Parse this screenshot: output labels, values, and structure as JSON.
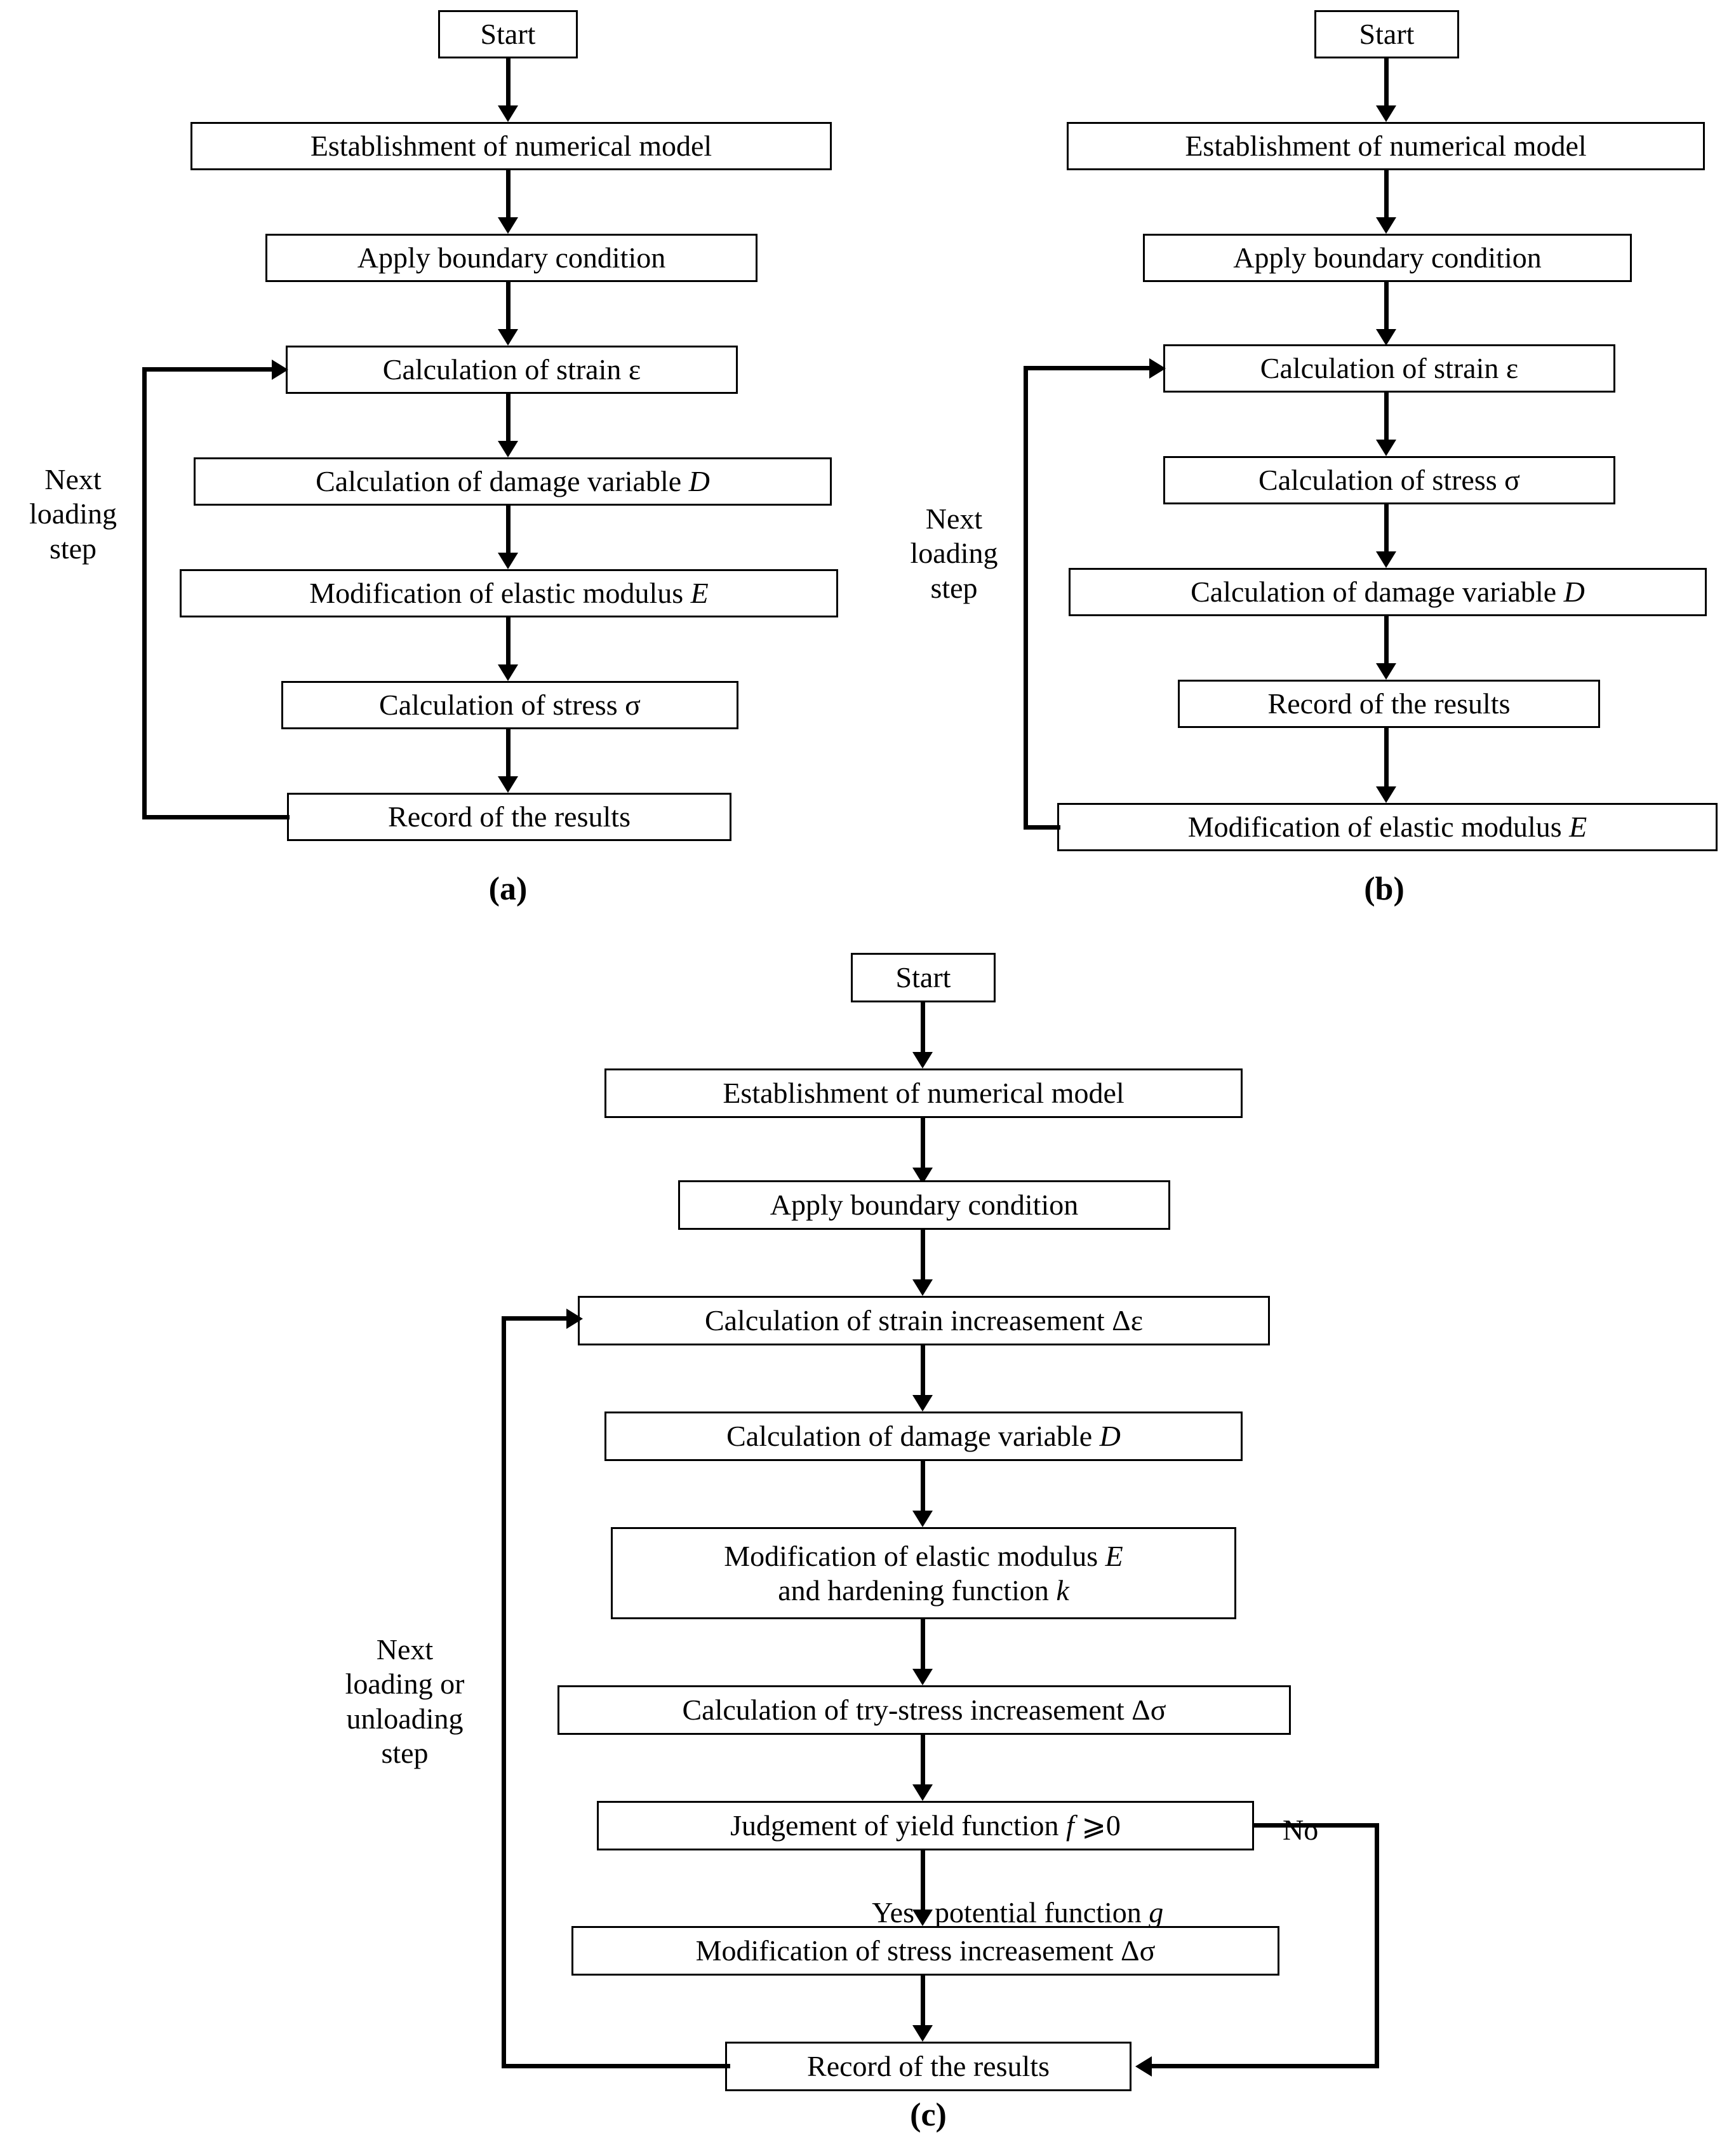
{
  "figure": {
    "type": "flowchart",
    "panels": [
      {
        "id": "a",
        "caption": "(a)",
        "nodes": [
          {
            "id": "a1",
            "label": "Start"
          },
          {
            "id": "a2",
            "label": "Establishment of numerical model"
          },
          {
            "id": "a3",
            "label": "Apply boundary condition"
          },
          {
            "id": "a4",
            "label": "Calculation of strain ε"
          },
          {
            "id": "a5",
            "label": "Calculation of damage variable D"
          },
          {
            "id": "a6",
            "label": "Modification of elastic modulus E"
          },
          {
            "id": "a7",
            "label": "Calculation of stress σ"
          },
          {
            "id": "a8",
            "label": "Record of the results"
          }
        ],
        "loop_label": "Next\nloading\nstep"
      },
      {
        "id": "b",
        "caption": "(b)",
        "nodes": [
          {
            "id": "b1",
            "label": "Start"
          },
          {
            "id": "b2",
            "label": "Establishment of numerical model"
          },
          {
            "id": "b3",
            "label": "Apply boundary condition"
          },
          {
            "id": "b4",
            "label": "Calculation of strain ε"
          },
          {
            "id": "b5",
            "label": "Calculation of stress σ"
          },
          {
            "id": "b6",
            "label": "Calculation of damage variable D"
          },
          {
            "id": "b7",
            "label": "Record of the results"
          },
          {
            "id": "b8",
            "label": "Modification of elastic modulus E"
          }
        ],
        "loop_label": "Next\nloading\nstep"
      },
      {
        "id": "c",
        "caption": "(c)",
        "nodes": [
          {
            "id": "c1",
            "label": "Start"
          },
          {
            "id": "c2",
            "label": "Establishment of numerical model"
          },
          {
            "id": "c3",
            "label": "Apply boundary condition"
          },
          {
            "id": "c4",
            "label": "Calculation of strain increasement  Δε"
          },
          {
            "id": "c5",
            "label": "Calculation of damage variable D"
          },
          {
            "id": "c6",
            "label": "Modification of elastic modulus E and hardening function k"
          },
          {
            "id": "c6_line1",
            "label": "Modification of elastic modulus E"
          },
          {
            "id": "c6_line2",
            "label": "and hardening function k"
          },
          {
            "id": "c7",
            "label": "Calculation of try-stress increasement Δσ"
          },
          {
            "id": "c8",
            "label": "Judgement of yield function  f ⩾0"
          },
          {
            "id": "c9",
            "label": "Modification of stress increasement Δσ"
          },
          {
            "id": "c10",
            "label": "Record of the results"
          }
        ],
        "edge_labels": {
          "no": "No",
          "yes": "Yes",
          "potential": "potential function g"
        },
        "loop_label": "Next\nloading or\nunloading\nstep"
      }
    ]
  }
}
